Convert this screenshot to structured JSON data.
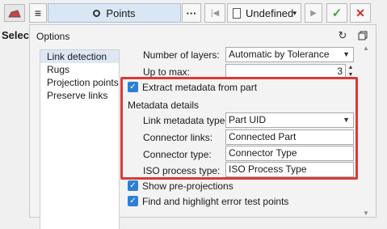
{
  "toolbar": {
    "points_label": "Points",
    "undefined_label": "Undefined"
  },
  "select_label": "Select",
  "panel": {
    "title": "Options"
  },
  "nav": {
    "items": [
      "Link detection",
      "Rugs",
      "Projection points",
      "Preserve links"
    ]
  },
  "form": {
    "number_of_layers_label": "Number of layers:",
    "number_of_layers_value": "Automatic by Tolerance",
    "up_to_max_label": "Up to max:",
    "up_to_max_value": "3",
    "extract_metadata_label": "Extract metadata from part",
    "metadata_details_label": "Metadata details",
    "link_metadata_type_label": "Link metadata type:",
    "link_metadata_type_value": "Part UID",
    "connector_links_label": "Connector links:",
    "connector_links_value": "Connected Part",
    "connector_type_label": "Connector type:",
    "connector_type_value": "Connector Type",
    "iso_process_type_label": "ISO process type:",
    "iso_process_type_value": "ISO Process Type",
    "show_preprojections_label": "Show pre-projections",
    "find_highlight_label": "Find and highlight error test points"
  },
  "colors": {
    "accent_blue": "#2f7fd1",
    "highlight_red": "#d83a3a",
    "confirm_green": "#3aa63a",
    "cancel_red": "#d12b2b"
  }
}
